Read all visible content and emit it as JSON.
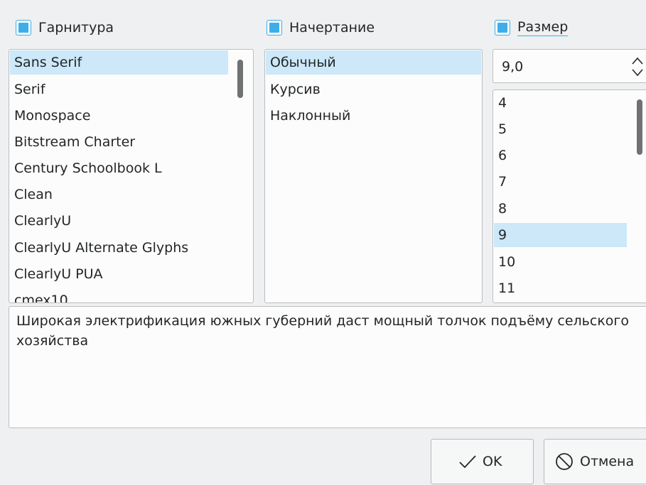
{
  "family": {
    "checkbox_label": "Гарнитура",
    "checked": true,
    "items": [
      {
        "label": "Sans Serif"
      },
      {
        "label": "Serif"
      },
      {
        "label": "Monospace"
      },
      {
        "label": "Bitstream Charter"
      },
      {
        "label": "Century Schoolbook L"
      },
      {
        "label": "Clean"
      },
      {
        "label": "ClearlyU"
      },
      {
        "label": "ClearlyU Alternate Glyphs"
      },
      {
        "label": "ClearlyU PUA"
      },
      {
        "label": "cmex10"
      }
    ],
    "selected": "Sans Serif"
  },
  "style": {
    "checkbox_label": "Начертание",
    "checked": true,
    "items": [
      {
        "label": "Обычный"
      },
      {
        "label": "Курсив"
      },
      {
        "label": "Наклонный"
      }
    ],
    "selected": "Обычный"
  },
  "size": {
    "checkbox_label": "Размер",
    "checked": true,
    "value": "9,0",
    "items": [
      {
        "label": "4"
      },
      {
        "label": "5"
      },
      {
        "label": "6"
      },
      {
        "label": "7"
      },
      {
        "label": "8"
      },
      {
        "label": "9"
      },
      {
        "label": "10"
      },
      {
        "label": "11"
      }
    ],
    "selected": "9"
  },
  "preview": {
    "text": "Широкая электрификация южных губерний даст мощный толчок подъёму сельского хозяйства"
  },
  "buttons": {
    "ok_label": "OK",
    "ok_icon": "checkmark-icon",
    "cancel_label": "Отмена",
    "cancel_icon": "cancel-circle-icon"
  },
  "colors": {
    "accent": "#3daee9",
    "selection": "#cce8f9",
    "window_bg": "#eff0f1",
    "field_bg": "#fcfcfc"
  }
}
